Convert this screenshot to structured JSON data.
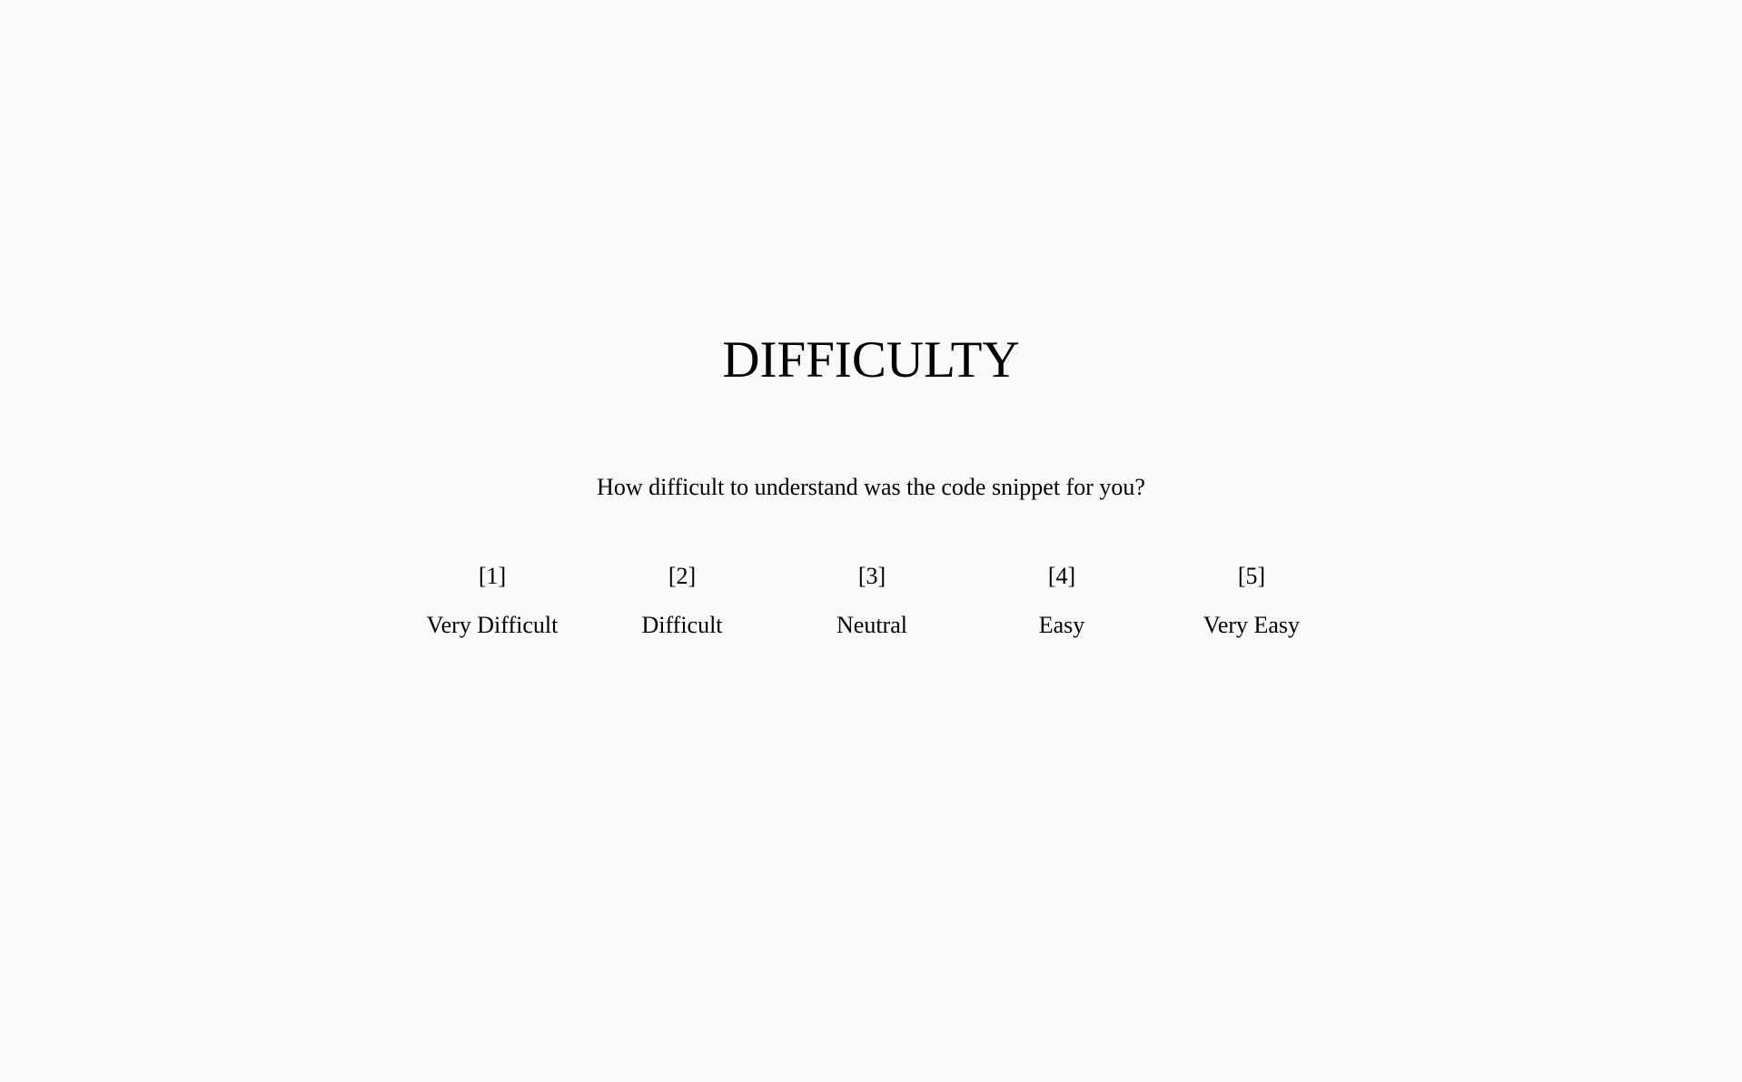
{
  "page": {
    "title": "DIFFICULTY",
    "question": "How difficult to understand was the code snippet for you?"
  },
  "scale": {
    "options": [
      {
        "key": "[1]",
        "label": "Very Difficult"
      },
      {
        "key": "[2]",
        "label": "Difficult"
      },
      {
        "key": "[3]",
        "label": "Neutral"
      },
      {
        "key": "[4]",
        "label": "Easy"
      },
      {
        "key": "[5]",
        "label": "Very Easy"
      }
    ]
  },
  "colors": {
    "background": "#fafafa",
    "text": "#000000"
  }
}
